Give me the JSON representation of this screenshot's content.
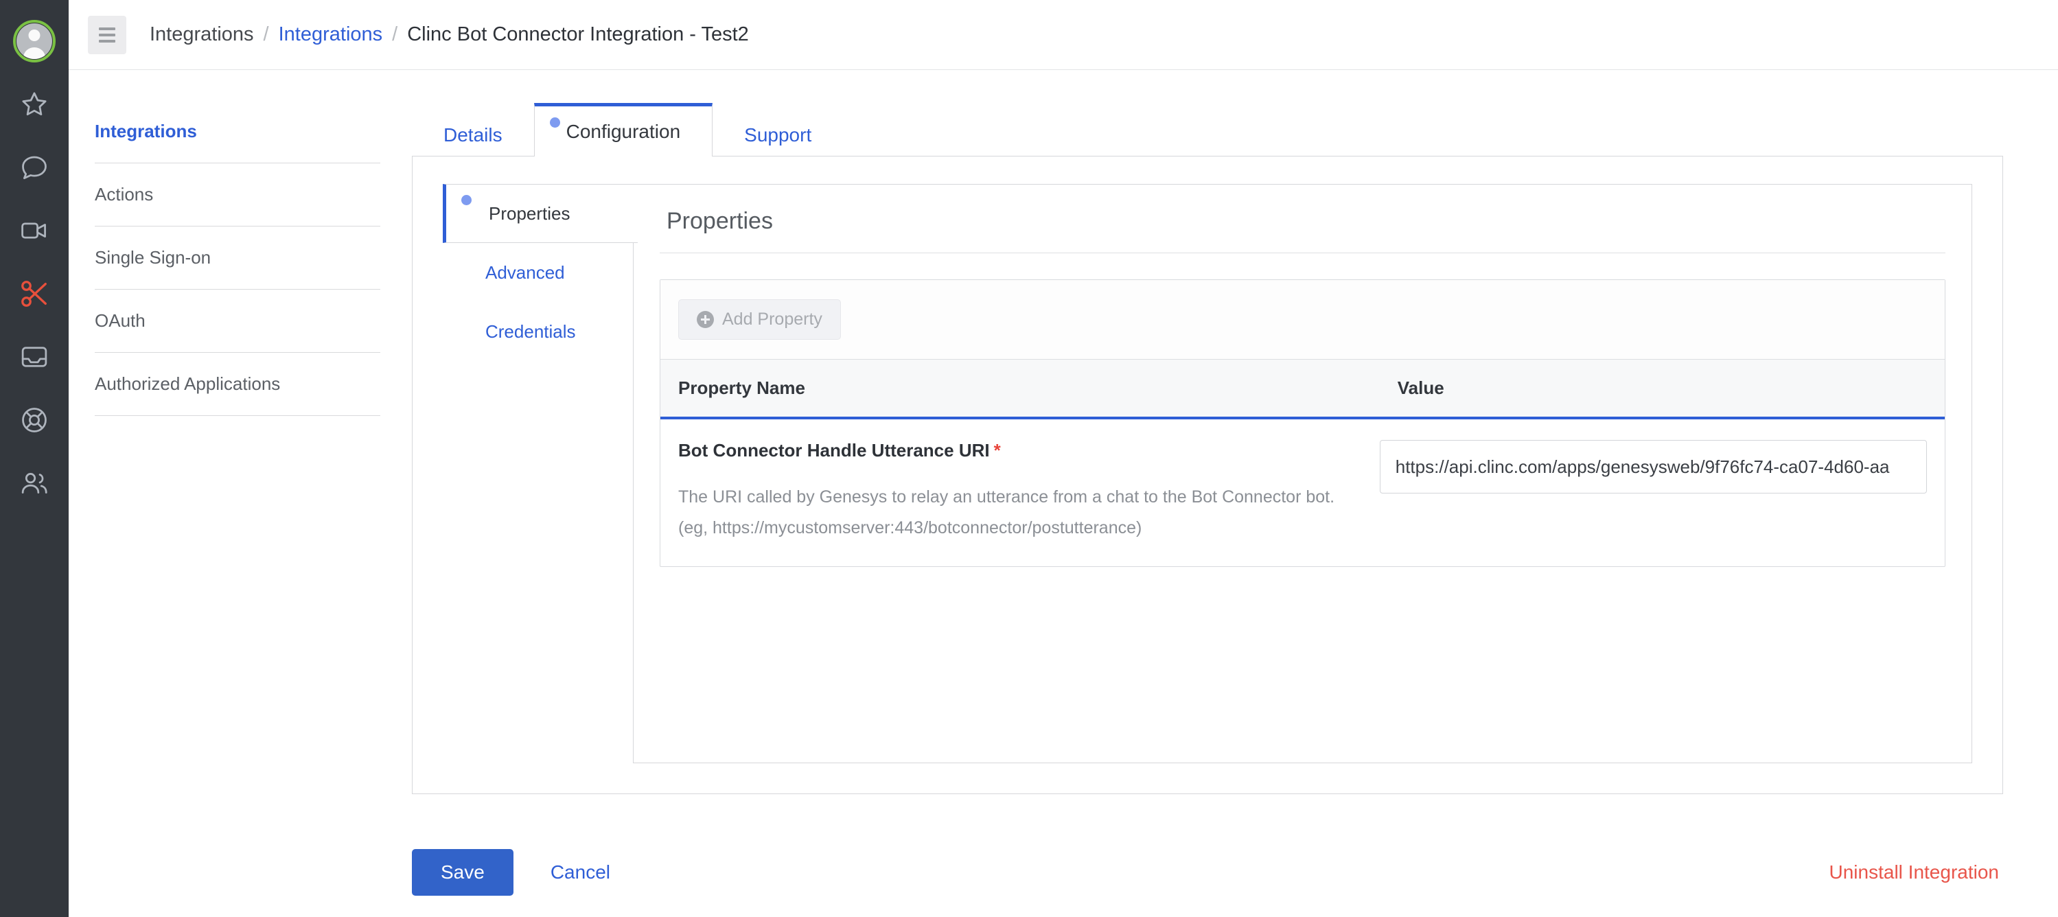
{
  "rail": {
    "items": [
      {
        "name": "user-avatar",
        "icon": "avatar-icon",
        "active": true
      },
      {
        "name": "favorites",
        "icon": "star-icon",
        "active": false
      },
      {
        "name": "chat",
        "icon": "speech-bubble-icon",
        "active": false
      },
      {
        "name": "video",
        "icon": "video-camera-icon",
        "active": false
      },
      {
        "name": "scissors",
        "icon": "scissors-icon",
        "active": true
      },
      {
        "name": "inbox",
        "icon": "inbox-icon",
        "active": false
      },
      {
        "name": "help",
        "icon": "lifebuoy-icon",
        "active": false
      },
      {
        "name": "people",
        "icon": "people-icon",
        "active": false
      }
    ]
  },
  "topbar": {
    "menu_icon": "hamburger-icon",
    "breadcrumb": [
      {
        "label": "Integrations",
        "type": "plain"
      },
      {
        "label": "Integrations",
        "type": "link"
      },
      {
        "label": "Clinc Bot Connector Integration - Test2",
        "type": "current"
      }
    ],
    "separator": "/"
  },
  "subnav": {
    "items": [
      {
        "label": "Integrations",
        "active": true
      },
      {
        "label": "Actions",
        "active": false
      },
      {
        "label": "Single Sign-on",
        "active": false
      },
      {
        "label": "OAuth",
        "active": false
      },
      {
        "label": "Authorized Applications",
        "active": false
      }
    ]
  },
  "tabs": [
    {
      "label": "Details",
      "active": false
    },
    {
      "label": "Configuration",
      "active": true
    },
    {
      "label": "Support",
      "active": false
    }
  ],
  "vtabs": [
    {
      "label": "Properties",
      "active": true
    },
    {
      "label": "Advanced",
      "active": false
    },
    {
      "label": "Credentials",
      "active": false
    }
  ],
  "panel": {
    "title": "Properties",
    "toolbar": {
      "add_property_label": "Add Property",
      "add_icon": "plus-circle-icon"
    },
    "table": {
      "headers": {
        "name": "Property Name",
        "value": "Value"
      },
      "rows": [
        {
          "name": "Bot Connector Handle Utterance URI",
          "required_marker": "*",
          "description": "The URI called by Genesys to relay an utterance from a chat to the Bot Connector bot. (eg, https://mycustomserver:443/botconnector/postutterance)",
          "value": "https://api.clinc.com/apps/genesysweb/9f76fc74-ca07-4d60-aa",
          "placeholder": ""
        }
      ]
    }
  },
  "footer": {
    "save_label": "Save",
    "cancel_label": "Cancel",
    "uninstall_label": "Uninstall Integration"
  },
  "colors": {
    "accent_blue": "#2f5ed6",
    "save_blue": "#3263c9",
    "danger_red": "#e8554a",
    "required_red": "#e8443a",
    "rail_bg": "#33373d",
    "avatar_ring_green": "#7ac143",
    "scissors_red": "#e8503c"
  }
}
